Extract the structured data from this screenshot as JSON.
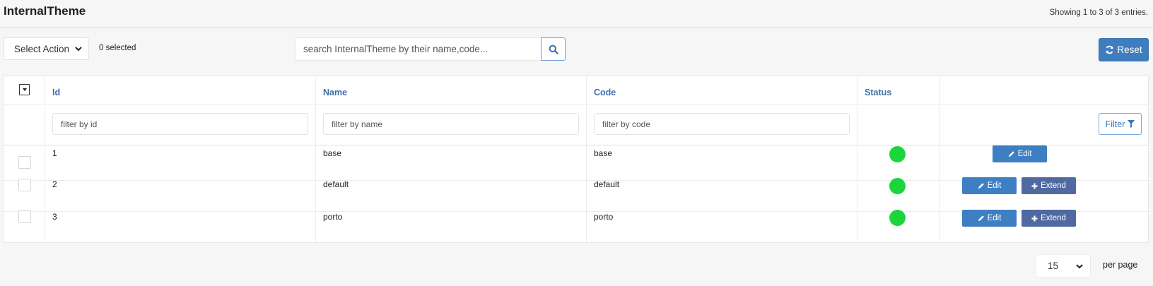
{
  "page": {
    "title": "InternalTheme",
    "entries_info": "Showing 1 to 3 of 3 entries."
  },
  "toolbar": {
    "action_select": "Select Action",
    "selected_count": "0 selected",
    "search_placeholder": "search InternalTheme by their name,code...",
    "reset_label": "Reset"
  },
  "table": {
    "columns": {
      "id": "Id",
      "name": "Name",
      "code": "Code",
      "status": "Status"
    },
    "filters": {
      "id": "filter by id",
      "name": "filter by name",
      "code": "filter by code",
      "button": "Filter"
    },
    "rows": [
      {
        "id": "1",
        "name": "base",
        "code": "base",
        "status": "active"
      },
      {
        "id": "2",
        "name": "default",
        "code": "default",
        "status": "active"
      },
      {
        "id": "3",
        "name": "porto",
        "code": "porto",
        "status": "active"
      }
    ],
    "edit_label": "Edit",
    "extend_label": "Extend"
  },
  "pagination": {
    "per_page_value": "15",
    "per_page_label": "per page"
  },
  "colors": {
    "primary": "#3f7dbf",
    "extend": "#4f6aa0",
    "status_active": "#1ad63c",
    "header_text": "#3f6fa8"
  }
}
